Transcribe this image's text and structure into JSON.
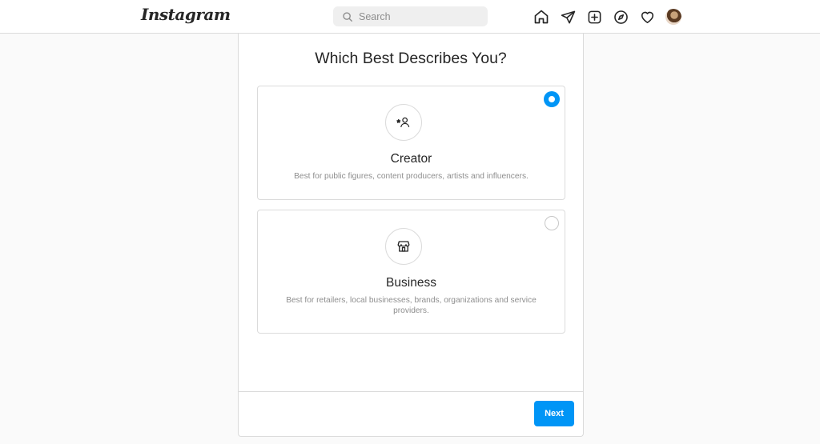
{
  "header": {
    "logo_text": "Instagram",
    "search": {
      "placeholder": "Search",
      "icon": "search-icon"
    },
    "nav_icons": [
      "home-icon",
      "direct-message-icon",
      "new-post-icon",
      "explore-icon",
      "activity-heart-icon",
      "profile-avatar"
    ]
  },
  "main": {
    "title": "Which Best Describes You?",
    "options": [
      {
        "id": "creator",
        "label": "Creator",
        "description": "Best for public figures, content producers, artists and influencers.",
        "icon": "creator-star-person-icon",
        "selected": true
      },
      {
        "id": "business",
        "label": "Business",
        "description": "Best for retailers, local businesses, brands, organizations and service providers.",
        "icon": "storefront-icon",
        "selected": false
      }
    ],
    "next_label": "Next"
  },
  "colors": {
    "accent": "#0095f6",
    "border": "#dbdbdb",
    "muted_text": "#8e8e8e",
    "background": "#fafafa"
  }
}
